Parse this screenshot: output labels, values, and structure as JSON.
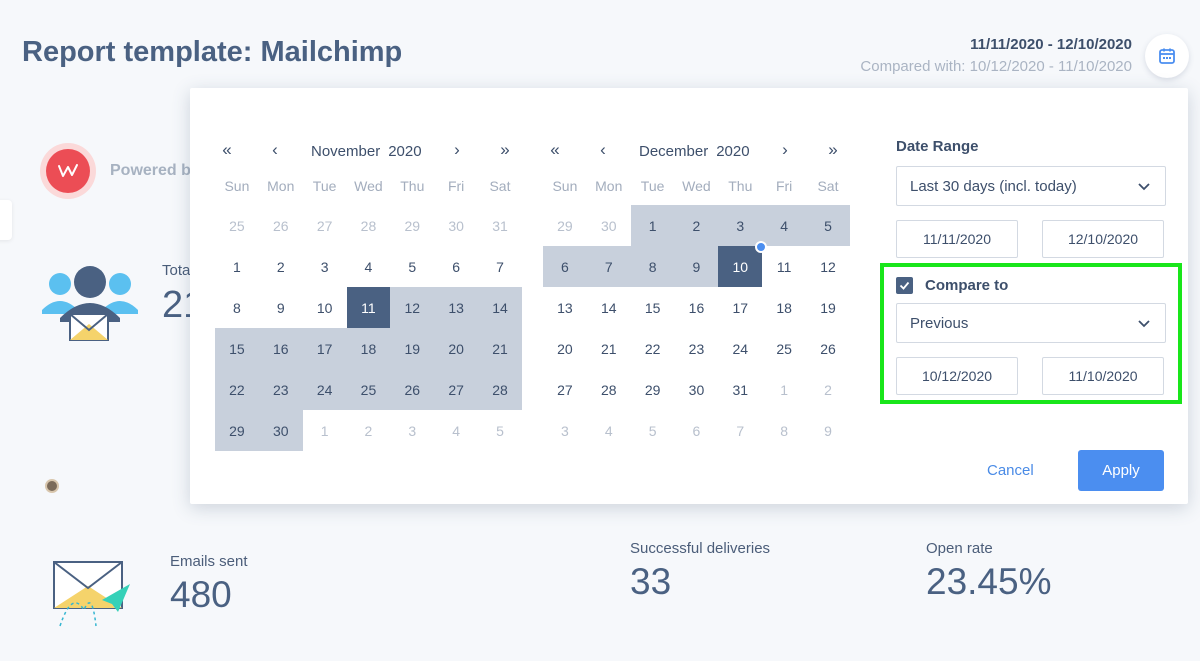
{
  "header": {
    "title": "Report template: Mailchimp",
    "date_range": "11/11/2020 - 12/10/2020",
    "compared_with": "Compared with: 10/12/2020 - 11/10/2020"
  },
  "dashboard": {
    "powered_by": "Powered b",
    "total_label": "Tota",
    "total_value": "21",
    "metrics": [
      {
        "label": "Emails sent",
        "value": "480"
      },
      {
        "label": "Successful deliveries",
        "value": "33"
      },
      {
        "label": "Open rate",
        "value": "23.45%"
      }
    ]
  },
  "picker": {
    "nav": {
      "prev_year": "«",
      "prev_month": "‹",
      "next_month": "›",
      "next_year": "»"
    },
    "weekdays": [
      "Sun",
      "Mon",
      "Tue",
      "Wed",
      "Thu",
      "Fri",
      "Sat"
    ],
    "months": [
      {
        "month": "November",
        "year": "2020",
        "weeks": [
          [
            {
              "d": "25",
              "o": 1
            },
            {
              "d": "26",
              "o": 1
            },
            {
              "d": "27",
              "o": 1
            },
            {
              "d": "28",
              "o": 1
            },
            {
              "d": "29",
              "o": 1
            },
            {
              "d": "30",
              "o": 1
            },
            {
              "d": "31",
              "o": 1
            }
          ],
          [
            {
              "d": "1"
            },
            {
              "d": "2"
            },
            {
              "d": "3"
            },
            {
              "d": "4"
            },
            {
              "d": "5"
            },
            {
              "d": "6"
            },
            {
              "d": "7"
            }
          ],
          [
            {
              "d": "8"
            },
            {
              "d": "9"
            },
            {
              "d": "10"
            },
            {
              "d": "11",
              "s": 1
            },
            {
              "d": "12",
              "r": 1
            },
            {
              "d": "13",
              "r": 1
            },
            {
              "d": "14",
              "r": 1
            }
          ],
          [
            {
              "d": "15",
              "r": 1
            },
            {
              "d": "16",
              "r": 1
            },
            {
              "d": "17",
              "r": 1
            },
            {
              "d": "18",
              "r": 1
            },
            {
              "d": "19",
              "r": 1
            },
            {
              "d": "20",
              "r": 1
            },
            {
              "d": "21",
              "r": 1
            }
          ],
          [
            {
              "d": "22",
              "r": 1
            },
            {
              "d": "23",
              "r": 1
            },
            {
              "d": "24",
              "r": 1
            },
            {
              "d": "25",
              "r": 1
            },
            {
              "d": "26",
              "r": 1
            },
            {
              "d": "27",
              "r": 1
            },
            {
              "d": "28",
              "r": 1
            }
          ],
          [
            {
              "d": "29",
              "r": 1
            },
            {
              "d": "30",
              "r": 1
            },
            {
              "d": "1",
              "o": 1
            },
            {
              "d": "2",
              "o": 1
            },
            {
              "d": "3",
              "o": 1
            },
            {
              "d": "4",
              "o": 1
            },
            {
              "d": "5",
              "o": 1
            }
          ]
        ]
      },
      {
        "month": "December",
        "year": "2020",
        "weeks": [
          [
            {
              "d": "29",
              "o": 1
            },
            {
              "d": "30",
              "o": 1
            },
            {
              "d": "1",
              "r": 1
            },
            {
              "d": "2",
              "r": 1
            },
            {
              "d": "3",
              "r": 1
            },
            {
              "d": "4",
              "r": 1
            },
            {
              "d": "5",
              "r": 1
            }
          ],
          [
            {
              "d": "6",
              "r": 1
            },
            {
              "d": "7",
              "r": 1
            },
            {
              "d": "8",
              "r": 1
            },
            {
              "d": "9",
              "r": 1
            },
            {
              "d": "10",
              "s": 1,
              "t": 1
            },
            {
              "d": "11"
            },
            {
              "d": "12"
            }
          ],
          [
            {
              "d": "13"
            },
            {
              "d": "14"
            },
            {
              "d": "15"
            },
            {
              "d": "16"
            },
            {
              "d": "17"
            },
            {
              "d": "18"
            },
            {
              "d": "19"
            }
          ],
          [
            {
              "d": "20"
            },
            {
              "d": "21"
            },
            {
              "d": "22"
            },
            {
              "d": "23"
            },
            {
              "d": "24"
            },
            {
              "d": "25"
            },
            {
              "d": "26"
            }
          ],
          [
            {
              "d": "27"
            },
            {
              "d": "28"
            },
            {
              "d": "29"
            },
            {
              "d": "30"
            },
            {
              "d": "31"
            },
            {
              "d": "1",
              "o": 1
            },
            {
              "d": "2",
              "o": 1
            }
          ],
          [
            {
              "d": "3",
              "o": 1
            },
            {
              "d": "4",
              "o": 1
            },
            {
              "d": "5",
              "o": 1
            },
            {
              "d": "6",
              "o": 1
            },
            {
              "d": "7",
              "o": 1
            },
            {
              "d": "8",
              "o": 1
            },
            {
              "d": "9",
              "o": 1
            }
          ]
        ]
      }
    ],
    "date_range_label": "Date Range",
    "date_range_value": "Last 30 days (incl. today)",
    "start_date": "11/11/2020",
    "end_date": "12/10/2020",
    "compare_checked": true,
    "compare_label": "Compare to",
    "compare_value": "Previous",
    "compare_start": "10/12/2020",
    "compare_end": "11/10/2020",
    "cancel_label": "Cancel",
    "apply_label": "Apply"
  },
  "colors": {
    "accent": "#4b8ef0",
    "selected": "#4a6182",
    "range": "#c8d0dc",
    "highlight": "#19e61a"
  }
}
